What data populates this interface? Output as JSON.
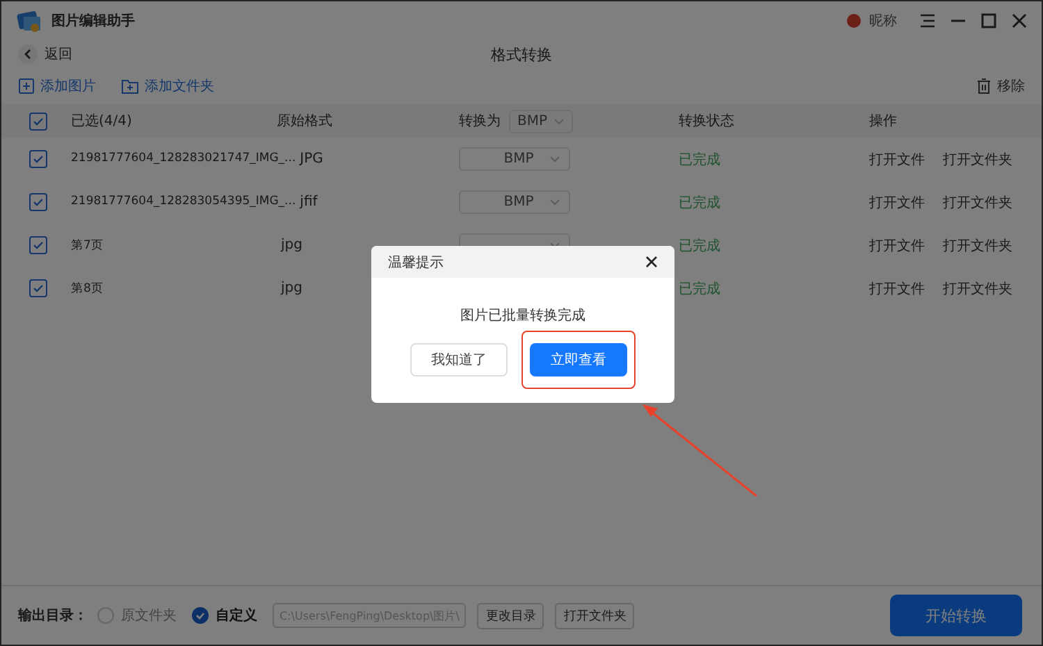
{
  "app": {
    "title": "图片编辑助手",
    "user": "昵称"
  },
  "nav": {
    "back": "返回",
    "title": "格式转换"
  },
  "toolbar": {
    "add_image": "添加图片",
    "add_folder": "添加文件夹",
    "remove": "移除"
  },
  "table": {
    "header": {
      "checked": true,
      "selected_count": "已选(4/4)",
      "format": "原始格式",
      "convert_to": "转换为",
      "convert_value": "BMP",
      "status": "转换状态",
      "actions": "操作"
    },
    "rows": [
      {
        "checked": true,
        "name": "21981777604_128283021747_IMG_...",
        "format": "JPG",
        "target": "BMP",
        "status": "已完成",
        "actions": [
          "打开文件",
          "打开文件夹"
        ]
      },
      {
        "checked": true,
        "name": "21981777604_128283054395_IMG_...",
        "format": "jfif",
        "target": "BMP",
        "status": "已完成",
        "actions": [
          "打开文件",
          "打开文件夹"
        ]
      },
      {
        "checked": true,
        "name": "第7页",
        "format": "jpg",
        "status": "已完成",
        "actions": [
          "打开文件",
          "打开文件夹"
        ]
      },
      {
        "checked": true,
        "name": "第8页",
        "format": "jpg",
        "status": "已完成",
        "actions": [
          "打开文件",
          "打开文件夹"
        ]
      }
    ]
  },
  "footer": {
    "label": "输出目录：",
    "options": [
      {
        "label": "原文件夹",
        "selected": false
      },
      {
        "label": "自定义",
        "selected": true
      }
    ],
    "path": "C:\\Users\\FengPing\\Desktop\\图片\\",
    "buttons": [
      "更改目录",
      "打开文件夹"
    ],
    "start": "开始转换"
  },
  "dialog": {
    "title": "温馨提示",
    "message": "图片已批量转换完成",
    "buttons": [
      {
        "label": "我知道了",
        "kind": "secondary",
        "highlighted": false
      },
      {
        "label": "立即查看",
        "kind": "primary",
        "highlighted": true
      }
    ]
  }
}
